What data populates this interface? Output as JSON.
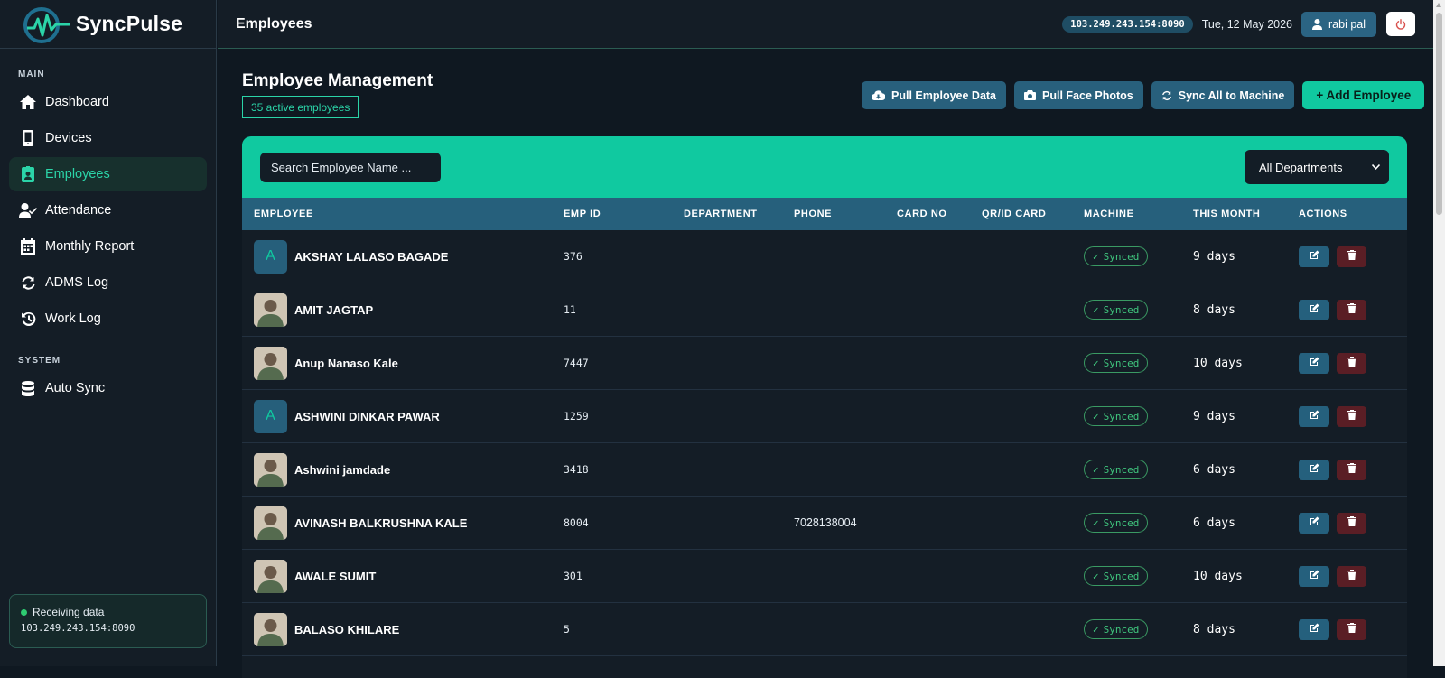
{
  "brand": {
    "name": "SyncPulse"
  },
  "sidebar": {
    "section_main": "MAIN",
    "section_system": "SYSTEM",
    "items": [
      {
        "label": "Dashboard",
        "icon": "home-icon"
      },
      {
        "label": "Devices",
        "icon": "mobile-icon"
      },
      {
        "label": "Employees",
        "icon": "id-badge-icon",
        "active": true
      },
      {
        "label": "Attendance",
        "icon": "user-check-icon"
      },
      {
        "label": "Monthly Report",
        "icon": "calendar-icon"
      },
      {
        "label": "ADMS Log",
        "icon": "refresh-icon"
      },
      {
        "label": "Work Log",
        "icon": "history-icon"
      }
    ],
    "system_items": [
      {
        "label": "Auto Sync",
        "icon": "database-icon"
      }
    ],
    "status": {
      "text": "Receiving data",
      "address": "103.249.243.154:8090"
    }
  },
  "topbar": {
    "title": "Employees",
    "ip": "103.249.243.154:8090",
    "date": "Tue, 12 May 2026",
    "user": "rabi pal"
  },
  "main": {
    "title": "Employee Management",
    "count_badge": "35 active employees",
    "buttons": {
      "pull_data": "Pull Employee Data",
      "pull_photos": "Pull Face Photos",
      "sync_all": "Sync All to Machine",
      "add": "+ Add Employee"
    },
    "search_placeholder": "Search Employee Name ...",
    "department_filter": "All Departments"
  },
  "table": {
    "headers": [
      "EMPLOYEE",
      "EMP ID",
      "DEPARTMENT",
      "PHONE",
      "CARD NO",
      "QR/ID CARD",
      "MACHINE",
      "THIS MONTH",
      "ACTIONS"
    ],
    "rows": [
      {
        "avatar": "A",
        "name": "AKSHAY LALASO BAGADE",
        "emp_id": "376",
        "department": "",
        "phone": "",
        "card_no": "",
        "qr": "",
        "machine": "Synced",
        "month": "9 days"
      },
      {
        "avatar": "",
        "name": "AMIT JAGTAP",
        "emp_id": "11",
        "department": "",
        "phone": "",
        "card_no": "",
        "qr": "",
        "machine": "Synced",
        "month": "8 days"
      },
      {
        "avatar": "",
        "name": "Anup Nanaso Kale",
        "emp_id": "7447",
        "department": "",
        "phone": "",
        "card_no": "",
        "qr": "",
        "machine": "Synced",
        "month": "10 days"
      },
      {
        "avatar": "A",
        "name": "ASHWINI DINKAR PAWAR",
        "emp_id": "1259",
        "department": "",
        "phone": "",
        "card_no": "",
        "qr": "",
        "machine": "Synced",
        "month": "9 days"
      },
      {
        "avatar": "",
        "name": "Ashwini jamdade",
        "emp_id": "3418",
        "department": "",
        "phone": "",
        "card_no": "",
        "qr": "",
        "machine": "Synced",
        "month": "6 days"
      },
      {
        "avatar": "",
        "name": "AVINASH BALKRUSHNA KALE",
        "emp_id": "8004",
        "department": "",
        "phone": "7028138004",
        "card_no": "",
        "qr": "",
        "machine": "Synced",
        "month": "6 days"
      },
      {
        "avatar": "",
        "name": "AWALE SUMIT",
        "emp_id": "301",
        "department": "",
        "phone": "",
        "card_no": "",
        "qr": "",
        "machine": "Synced",
        "month": "10 days"
      },
      {
        "avatar": "",
        "name": "BALASO KHILARE",
        "emp_id": "5",
        "department": "",
        "phone": "",
        "card_no": "",
        "qr": "",
        "machine": "Synced",
        "month": "8 days"
      }
    ]
  },
  "colors": {
    "accent": "#10c9a0",
    "sidebar_bg": "#141d26",
    "header_row": "#26607c",
    "synced": "#3fc47d",
    "delete": "#5a1e25"
  }
}
